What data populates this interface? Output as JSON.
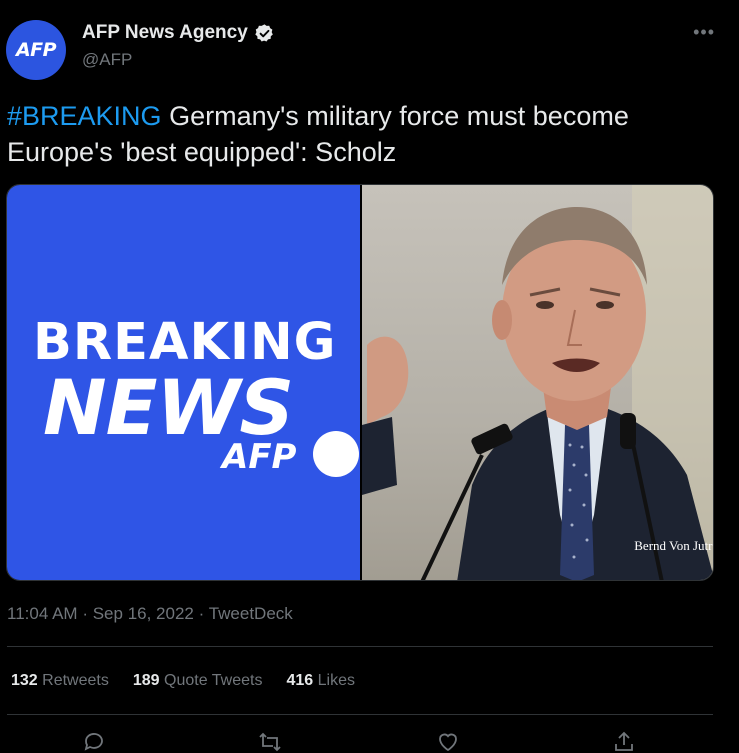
{
  "account": {
    "avatar_text": "AFP",
    "display_name": "AFP News Agency",
    "handle": "@AFP",
    "verified": true
  },
  "menu": {
    "more_label": "•••"
  },
  "tweet": {
    "hashtag": "#BREAKING",
    "text": " Germany's military force must become Europe's 'best equipped': Scholz"
  },
  "media": {
    "left_image": {
      "line1": "BREAKING",
      "line2": "NEWS",
      "logo": "AFP"
    },
    "right_image": {
      "credit": "Bernd Von Jutro"
    }
  },
  "meta": {
    "time": "11:04 AM",
    "separator": "·",
    "date": "Sep 16, 2022",
    "source": "TweetDeck"
  },
  "stats": [
    {
      "count": "132",
      "label": "Retweets"
    },
    {
      "count": "189",
      "label": "Quote Tweets"
    },
    {
      "count": "416",
      "label": "Likes"
    }
  ],
  "actions": [
    "reply-icon",
    "retweet-icon",
    "like-icon",
    "share-icon"
  ],
  "colors": {
    "background": "#000000",
    "text": "#e7e9ea",
    "muted": "#71767b",
    "link": "#1d9bf0",
    "afp_blue": "#2f55e6"
  }
}
